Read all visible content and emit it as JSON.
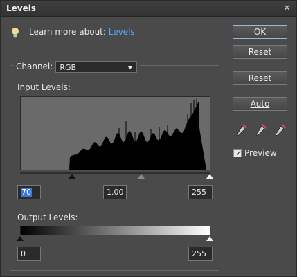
{
  "window": {
    "title": "Levels",
    "close_glyph": "×"
  },
  "learn": {
    "prefix": "Learn more about:",
    "link": "Levels",
    "icon": "lightbulb-icon"
  },
  "channel": {
    "label": "Channel:",
    "value": "RGB"
  },
  "input_levels": {
    "label": "Input Levels:",
    "black": "70",
    "gamma": "1.00",
    "white": "255"
  },
  "output_levels": {
    "label": "Output Levels:",
    "black": "0",
    "white": "255"
  },
  "buttons": {
    "ok": "OK",
    "reset_top": "Reset",
    "reset": "Reset",
    "auto": "Auto"
  },
  "droppers": [
    "black-eyedropper-icon",
    "gray-eyedropper-icon",
    "white-eyedropper-icon"
  ],
  "preview": {
    "label": "Preview",
    "checked": true
  },
  "colors": {
    "link": "#5aa7ff",
    "histogram_bg": "#6a6a6a",
    "histogram_fill": "#000000"
  }
}
